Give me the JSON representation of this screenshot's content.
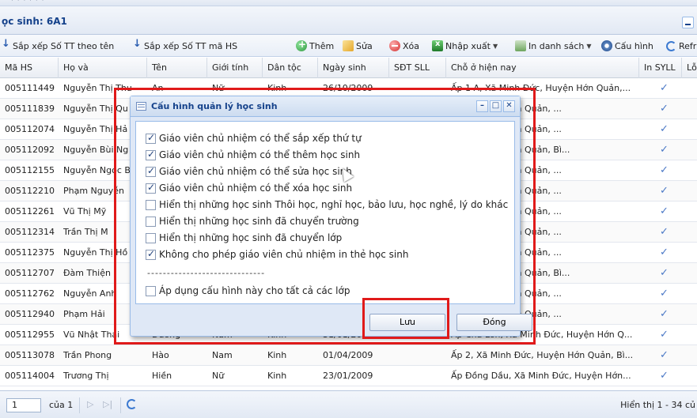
{
  "window": {
    "caption": "· · · · · ·",
    "title": "ọc sinh: 6A1"
  },
  "toolbar": {
    "sort_name": "Sắp xếp Số TT theo tên",
    "sort_code": "Sắp xếp Số TT mã HS",
    "add": "Thêm",
    "edit": "Sửa",
    "delete": "Xóa",
    "import_export": "Nhập xuất",
    "print_list": "In danh sách",
    "config": "Cấu hình",
    "refresh": "Refr"
  },
  "grid": {
    "columns": [
      "Mã HS",
      "Họ và",
      "Tên",
      "Giới tính",
      "Dân tộc",
      "Ngày sinh",
      "SĐT SLL",
      "Chỗ ở hiện nay",
      "In SYLL",
      "Lỗ"
    ],
    "rows": [
      {
        "code": "005111449",
        "surname": "Nguyễn Thị Thu",
        "name": "An",
        "gender": "Nữ",
        "ethnic": "Kinh",
        "dob": "26/10/2009",
        "address": "Ấp 1 A, Xã Minh Đức, Huyện Hớn Quản,..."
      },
      {
        "code": "005111839",
        "surname": "Nguyễn Thị Qu",
        "name": "",
        "gender": "",
        "ethnic": "",
        "dob": "",
        "address": "Đức, Huyện Hớn Quản, ..."
      },
      {
        "code": "005112074",
        "surname": "Nguyễn Thị Hả",
        "name": "",
        "gender": "",
        "ethnic": "",
        "dob": "",
        "address": "Đức, Huyện Hớn Quản, ..."
      },
      {
        "code": "005112092",
        "surname": "Nguyễn Bùi Ng",
        "name": "",
        "gender": "",
        "ethnic": "",
        "dob": "",
        "address": "Đức, Huyện Hớn Quản, Bì..."
      },
      {
        "code": "005112155",
        "surname": "Nguyễn Ngọc B",
        "name": "",
        "gender": "",
        "ethnic": "",
        "dob": "",
        "address": "Đức, Huyện Hớn Quản, ..."
      },
      {
        "code": "005112210",
        "surname": "Phạm Nguyễn",
        "name": "",
        "gender": "",
        "ethnic": "",
        "dob": "",
        "address": "Đức, Huyện Hớn Quản, ..."
      },
      {
        "code": "005112261",
        "surname": "Vũ Thị Mỹ",
        "name": "",
        "gender": "",
        "ethnic": "",
        "dob": "",
        "address": "Đức, Huyện Hớn Quản, ..."
      },
      {
        "code": "005112314",
        "surname": "Trần Thị M",
        "name": "",
        "gender": "",
        "ethnic": "",
        "dob": "",
        "address": "Đức, Huyện Hớn Quản, ..."
      },
      {
        "code": "005112375",
        "surname": "Nguyễn Thị Hồ",
        "name": "",
        "gender": "",
        "ethnic": "",
        "dob": "",
        "address": "Đức, Huyện Hớn Quản, ..."
      },
      {
        "code": "005112707",
        "surname": "Đàm Thiện",
        "name": "",
        "gender": "",
        "ethnic": "",
        "dob": "",
        "address": "Đức, Huyện Hớn Quản, Bì..."
      },
      {
        "code": "005112762",
        "surname": "Nguyễn Anh",
        "name": "",
        "gender": "",
        "ethnic": "",
        "dob": "",
        "address": "Đức, Huyện Hớn Quản, ..."
      },
      {
        "code": "005112940",
        "surname": "Phạm Hải",
        "name": "",
        "gender": "",
        "ethnic": "",
        "dob": "",
        "address": "Đức, Huyện Hớn Quản, ..."
      },
      {
        "code": "005112955",
        "surname": "Vũ Nhật Thái",
        "name": "Dương",
        "gender": "Nam",
        "ethnic": "Kinh",
        "dob": "31/01/2009",
        "address": "Ấp Chà Lon, Xã Minh Đức, Huyện Hớn Q..."
      },
      {
        "code": "005113078",
        "surname": "Trần Phong",
        "name": "Hào",
        "gender": "Nam",
        "ethnic": "Kinh",
        "dob": "01/04/2009",
        "address": "Ấp 2, Xã Minh Đức, Huyện Hớn Quản, Bì..."
      },
      {
        "code": "005114004",
        "surname": "Trương Thị",
        "name": "Hiền",
        "gender": "Nữ",
        "ethnic": "Kinh",
        "dob": "23/01/2009",
        "address": "Ấp Đồng Dầu, Xã Minh Đức, Huyện Hớn..."
      }
    ]
  },
  "pager": {
    "page": "1",
    "of": "của 1",
    "info": "Hiển thị 1 - 34 củ"
  },
  "dialog": {
    "title": "Cấu hình quản lý học sinh",
    "options": [
      {
        "label": "Giáo viên chủ nhiệm có thể sắp xếp thứ tự",
        "checked": true
      },
      {
        "label": "Giáo viên chủ nhiệm có thể thêm học sinh",
        "checked": true
      },
      {
        "label": "Giáo viên chủ nhiệm có thể sửa học sinh",
        "checked": true
      },
      {
        "label": "Giáo viên chủ nhiệm có thể xóa học sinh",
        "checked": true
      },
      {
        "label": "Hiển thị những học sinh Thôi học, nghỉ học, bảo lưu, học nghề, lý do khác",
        "checked": false
      },
      {
        "label": "Hiển thị những học sinh đã chuyển trường",
        "checked": false
      },
      {
        "label": "Hiển thị những học sinh đã chuyển lớp",
        "checked": false
      },
      {
        "label": "Không cho phép giáo viên chủ nhiệm in thẻ học sinh",
        "checked": true
      }
    ],
    "separator": "------------------------------",
    "apply_all": {
      "label": "Áp dụng cấu hình này cho tất cả các lớp",
      "checked": false
    },
    "save": "Lưu",
    "close": "Đóng"
  },
  "colors": {
    "accent": "#15428b",
    "highlight": "#e01a1a",
    "dialog_bg": "#dfe8f6"
  }
}
